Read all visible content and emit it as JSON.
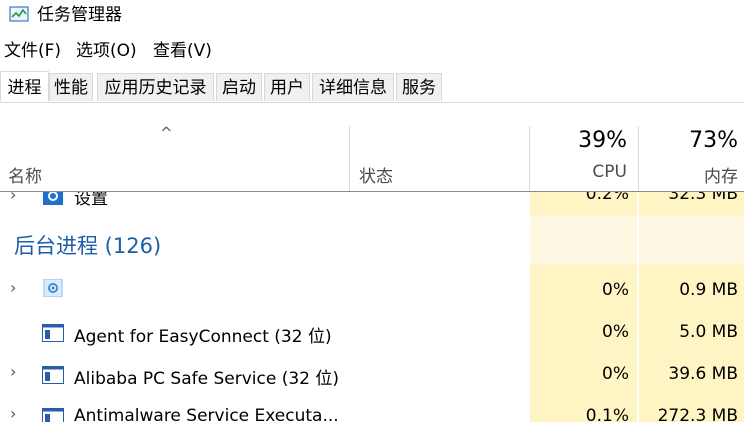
{
  "window": {
    "title": "任务管理器"
  },
  "menu": [
    "文件(F)",
    "选项(O)",
    "查看(V)"
  ],
  "tabs": [
    "进程",
    "性能",
    "应用历史记录",
    "启动",
    "用户",
    "详细信息",
    "服务"
  ],
  "active_tab": "进程",
  "header": {
    "name_label": "名称",
    "status_label": "状态",
    "cpu_percent": "39%",
    "cpu_label": "CPU",
    "mem_percent": "73%",
    "mem_label": "内存"
  },
  "rows": {
    "partial_top": {
      "name": "设置",
      "cpu": "0.2%",
      "mem": "32.3 MB"
    },
    "group": {
      "title": "后台进程 (126)"
    },
    "items": [
      {
        "name": "",
        "cpu": "0%",
        "mem": "0.9 MB",
        "icon": "gear-icon",
        "expandable": true
      },
      {
        "name": "Agent for EasyConnect (32 位)",
        "cpu": "0%",
        "mem": "5.0 MB",
        "icon": "window-app-icon",
        "expandable": false
      },
      {
        "name": "Alibaba PC Safe Service (32 位)",
        "cpu": "0%",
        "mem": "39.6 MB",
        "icon": "window-app-icon",
        "expandable": true
      },
      {
        "name": "Antimalware Service Executa...",
        "cpu": "0.1%",
        "mem": "272.3 MB",
        "icon": "window-app-icon",
        "expandable": true
      }
    ]
  },
  "colors": {
    "accent_blue": "#1c5ea8",
    "heat_yellow": "#fff4c4",
    "heat_light": "#fff9e4"
  }
}
